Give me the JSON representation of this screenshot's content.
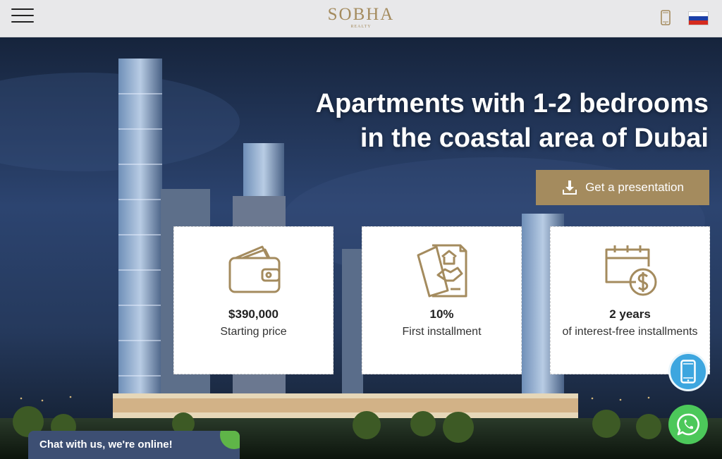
{
  "header": {
    "logo_main": "SOBHA",
    "logo_sub": "REALTY",
    "menu_icon": "hamburger-menu-icon",
    "phone_icon": "phone-icon",
    "flag_icon": "russian-flag-icon"
  },
  "hero": {
    "headline_line1": "Apartments with 1-2 bedrooms",
    "headline_line2": "in the coastal area of Dubai",
    "cta_label": "Get a presentation",
    "cta_icon": "download-icon"
  },
  "cards": [
    {
      "value": "$390,000",
      "label": "Starting price",
      "icon": "wallet-icon"
    },
    {
      "value": "10%",
      "label": "First installment",
      "icon": "contract-handshake-icon"
    },
    {
      "value": "2 years",
      "label": "of interest-free installments",
      "icon": "calendar-dollar-icon"
    }
  ],
  "floating": {
    "phone_icon": "mobile-phone-icon",
    "whatsapp_icon": "whatsapp-icon"
  },
  "chat": {
    "label": "Chat with us, we're online!"
  },
  "colors": {
    "gold": "#a48b5e",
    "header_bg": "#e8e8ea",
    "phone_fab": "#3da6df",
    "whatsapp_fab": "#4cc85a",
    "chat_bg": "#3d4f73"
  }
}
